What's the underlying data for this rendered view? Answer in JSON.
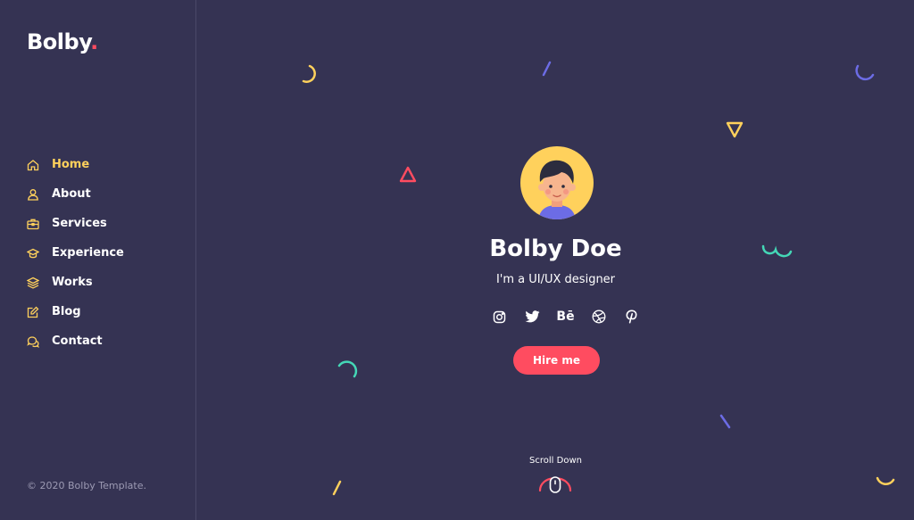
{
  "brand": {
    "name": "Bolby",
    "dot": ".",
    "accent": "#FF4C60"
  },
  "nav": {
    "items": [
      {
        "label": "Home",
        "icon": "home-icon",
        "active": true
      },
      {
        "label": "About",
        "icon": "user-icon"
      },
      {
        "label": "Services",
        "icon": "briefcase-icon"
      },
      {
        "label": "Experience",
        "icon": "graduation-cap-icon"
      },
      {
        "label": "Works",
        "icon": "layers-icon"
      },
      {
        "label": "Blog",
        "icon": "edit-icon"
      },
      {
        "label": "Contact",
        "icon": "chat-bubbles-icon"
      }
    ]
  },
  "footer": {
    "copyright": "© 2020 Bolby Template."
  },
  "hero": {
    "name": "Bolby Doe",
    "role": "I'm a UI/UX designer",
    "cta_label": "Hire me",
    "social": [
      "instagram-icon",
      "twitter-icon",
      "behance-icon",
      "dribbble-icon",
      "pinterest-icon"
    ],
    "behance_text": "Bē",
    "scroll_label": "Scroll Down"
  },
  "colors": {
    "background": "#353353",
    "highlight": "#FFD15C",
    "primary": "#FF4C60",
    "teal": "#44D7B6",
    "purple": "#6C6CE5"
  }
}
